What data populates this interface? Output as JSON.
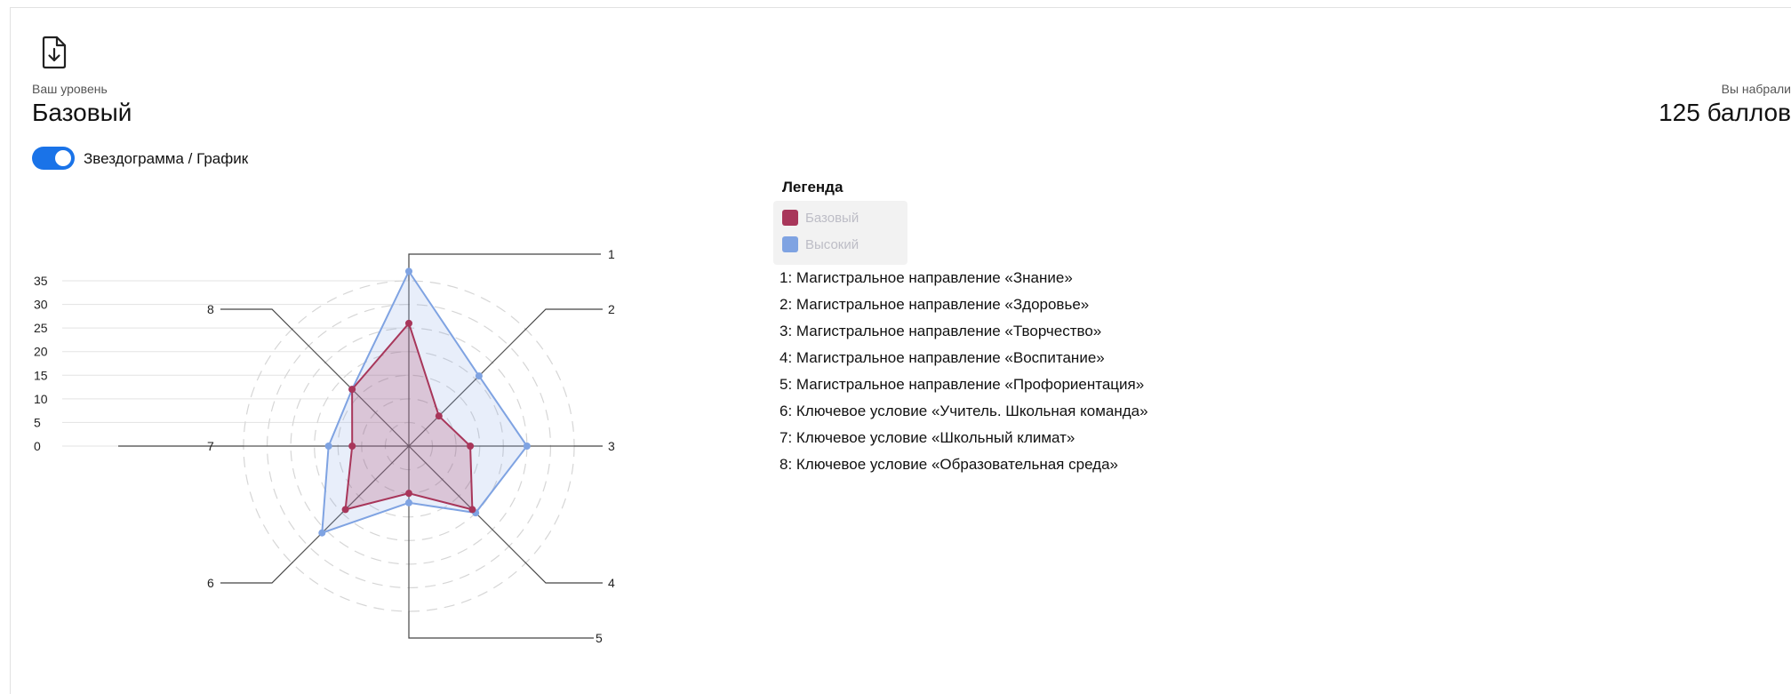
{
  "header": {
    "download_icon": "file-download-icon",
    "level_label": "Ваш уровень",
    "level_value": "Базовый",
    "score_label": "Вы набрали",
    "score_value": "125 баллов"
  },
  "view_toggle": {
    "label": "Звездограмма / График",
    "checked": true,
    "color": "#1a73e8"
  },
  "legend": {
    "title": "Легенда",
    "items": [
      {
        "name": "Базовый",
        "color": "#a8365a"
      },
      {
        "name": "Высокий",
        "color": "#7fa3e2"
      }
    ],
    "directions": [
      "1: Магистральное направление «Знание»",
      "2: Магистральное направление «Здоровье»",
      "3: Магистральное направление «Творчество»",
      "4: Магистральное направление «Воспитание»",
      "5: Магистральное направление «Профориентация»",
      "6: Ключевое условие «Учитель. Школьная команда»",
      "7: Ключевое условие «Школьный климат»",
      "8: Ключевое условие «Образовательная среда»"
    ]
  },
  "chart_data": {
    "type": "radar",
    "categories": [
      "1",
      "2",
      "3",
      "4",
      "5",
      "6",
      "7",
      "8"
    ],
    "yticks": [
      0,
      5,
      10,
      15,
      20,
      25,
      30,
      35
    ],
    "ylim": [
      0,
      35
    ],
    "series": [
      {
        "name": "Базовый",
        "color": "#a8365a",
        "values": [
          26,
          9,
          13,
          19,
          10,
          19,
          12,
          17
        ]
      },
      {
        "name": "Высокий",
        "color": "#7fa3e2",
        "values": [
          37,
          21,
          25,
          20,
          12,
          26,
          17,
          17
        ]
      }
    ]
  }
}
